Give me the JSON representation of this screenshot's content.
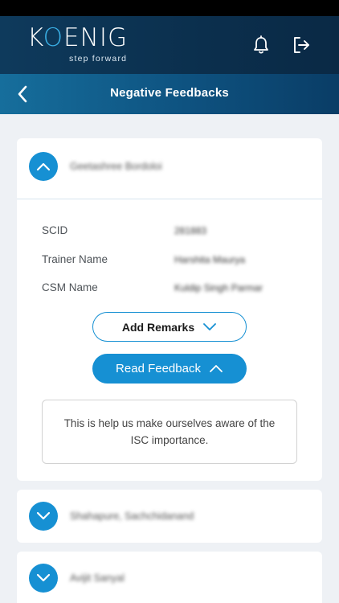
{
  "header": {
    "logo_text_k": "K",
    "logo_text_o": "O",
    "logo_text_rest": "ENIG",
    "logo_tagline": "step forward",
    "icons": [
      "bell-icon",
      "logout-icon"
    ]
  },
  "subheader": {
    "back_icon": "chevron-left-icon",
    "title": "Negative Feedbacks"
  },
  "cards": [
    {
      "name": "Geetashree Bordoloi",
      "expanded": true,
      "fields": [
        {
          "label": "SCID",
          "value": "281883"
        },
        {
          "label": "Trainer Name",
          "value": "Harshita Maurya"
        },
        {
          "label": "CSM Name",
          "value": "Kuldip Singh Parmar"
        }
      ],
      "add_remarks_label": "Add Remarks",
      "read_feedback_label": "Read Feedback",
      "feedback_text": "This is help us make ourselves aware of the ISC importance."
    },
    {
      "name": "Shahapure, Sachchidanand",
      "expanded": false
    },
    {
      "name": "Avijit Sanyal",
      "expanded": false
    }
  ],
  "colors": {
    "header_bg": "#0e3a5c",
    "subheader_bg": "#0e5280",
    "accent": "#1690d3",
    "logo_accent": "#3ab0e6",
    "page_bg": "#eef1f5"
  }
}
